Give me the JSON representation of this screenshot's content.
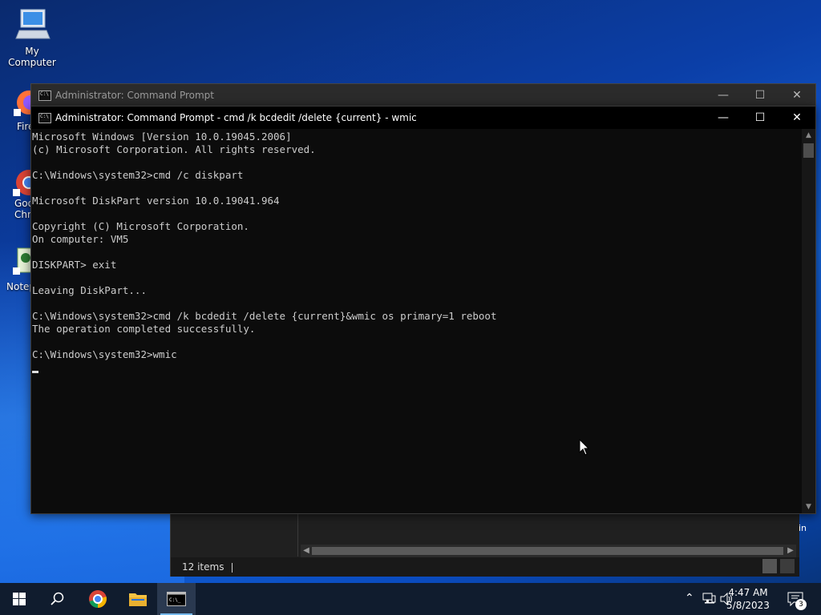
{
  "desktop": {
    "icons": [
      {
        "label": "My Computer"
      },
      {
        "label": "Fire"
      },
      {
        "label": "Goo Chr"
      },
      {
        "label": "Notep"
      }
    ]
  },
  "explorer": {
    "status_items": "12 items",
    "tail_text": "in"
  },
  "cmd_back": {
    "title": "Administrator:  Command Prompt"
  },
  "cmd_front": {
    "title": "Administrator:  Command Prompt - cmd  /k bcdedit /delete {current} - wmic",
    "console_lines": [
      "Microsoft Windows [Version 10.0.19045.2006]",
      "(c) Microsoft Corporation. All rights reserved.",
      "",
      "C:\\Windows\\system32>cmd /c diskpart",
      "",
      "Microsoft DiskPart version 10.0.19041.964",
      "",
      "Copyright (C) Microsoft Corporation.",
      "On computer: VM5",
      "",
      "DISKPART> exit",
      "",
      "Leaving DiskPart...",
      "",
      "C:\\Windows\\system32>cmd /k bcdedit /delete {current}&wmic os primary=1 reboot",
      "The operation completed successfully.",
      "",
      "C:\\Windows\\system32>wmic"
    ]
  },
  "taskbar": {
    "time": "4:47 AM",
    "date": "5/8/2023",
    "notification_count": "3",
    "apps": [
      "start-icon",
      "search-icon",
      "chrome-icon",
      "file-explorer-icon",
      "command-prompt-icon"
    ]
  },
  "colors": {
    "console_bg": "#0c0c0c",
    "console_text": "#cccccc",
    "taskbar_bg": "#101c2e",
    "accent": "#76b9ed"
  }
}
